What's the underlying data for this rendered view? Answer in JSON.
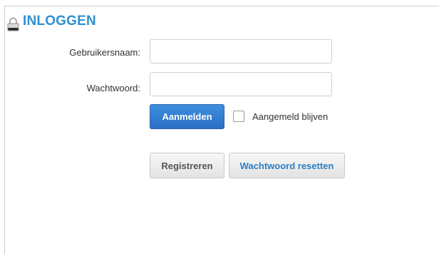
{
  "header": {
    "title": "INLOGGEN",
    "icon": "lock-icon"
  },
  "form": {
    "username_label": "Gebruikersnaam:",
    "username_value": "",
    "password_label": "Wachtwoord:",
    "password_value": "",
    "login_button": "Aanmelden",
    "remember_label": "Aangemeld blijven",
    "remember_checked": false,
    "register_button": "Registreren",
    "reset_button": "Wachtwoord resetten"
  },
  "colors": {
    "title": "#2f8fd0",
    "primary_button": "#2a6fc4",
    "reset_link_text": "#2f7fc3"
  }
}
